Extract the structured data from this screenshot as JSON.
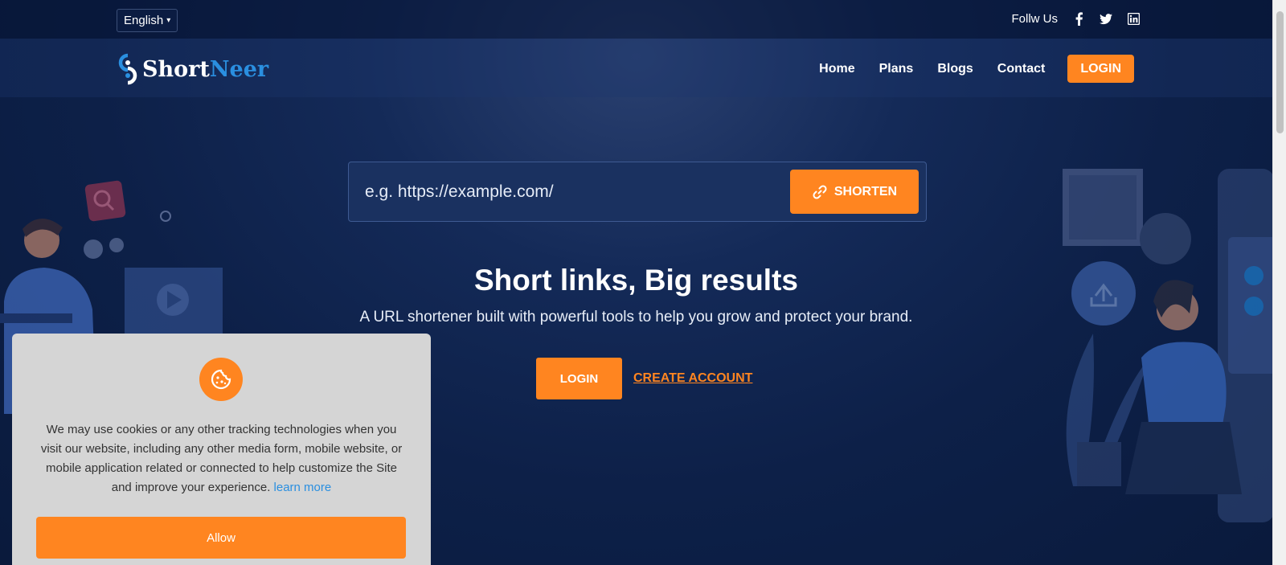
{
  "header": {
    "language": "English",
    "follow_label": "Follw Us",
    "social_icons": [
      "facebook-icon",
      "twitter-icon",
      "linkedin-icon"
    ]
  },
  "brand": {
    "name_part1": "Short",
    "name_part2": "Neer"
  },
  "nav": {
    "items": [
      {
        "label": "Home"
      },
      {
        "label": "Plans"
      },
      {
        "label": "Blogs"
      },
      {
        "label": "Contact"
      }
    ],
    "login_label": "LOGIN"
  },
  "shorten": {
    "placeholder": "e.g. https://example.com/",
    "button_label": "SHORTEN",
    "button_icon": "link-icon"
  },
  "hero": {
    "title": "Short links, Big results",
    "subtitle": "A URL shortener built with powerful tools to help you grow and protect your brand.",
    "login_label": "LOGIN",
    "create_account_label": "CREATE ACCOUNT"
  },
  "cookie": {
    "icon": "cookie-icon",
    "text": "We may use cookies or any other tracking technologies when you visit our website, including any other media form, mobile website, or mobile application related or connected to help customize the Site and improve your experience.",
    "learn_more": "learn more",
    "allow_label": "Allow"
  },
  "colors": {
    "accent": "#ff8520",
    "brand_blue": "#2a8fe0",
    "background": "#0d2048",
    "cookie_bg": "#d5d5d5"
  }
}
